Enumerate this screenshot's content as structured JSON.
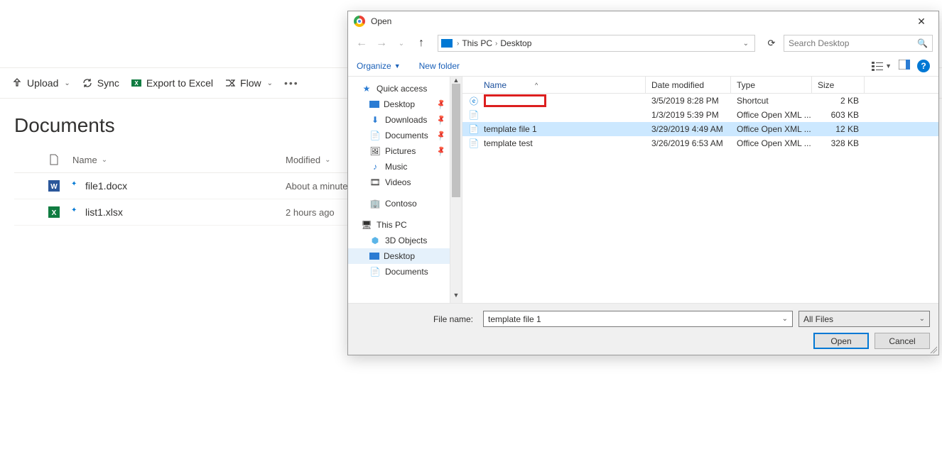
{
  "sharepoint": {
    "toolbar": {
      "upload": "Upload",
      "sync": "Sync",
      "export": "Export to Excel",
      "flow": "Flow"
    },
    "title": "Documents",
    "columns": {
      "name": "Name",
      "modified": "Modified"
    },
    "files": [
      {
        "name": "file1.docx",
        "modified": "About a minute"
      },
      {
        "name": "list1.xlsx",
        "modified": "2 hours ago"
      }
    ]
  },
  "dialog": {
    "title": "Open",
    "breadcrumb": {
      "root": "This PC",
      "leaf": "Desktop"
    },
    "search_placeholder": "Search Desktop",
    "toolbar": {
      "organize": "Organize",
      "newfolder": "New folder"
    },
    "tree": {
      "quick_access": "Quick access",
      "items_pinned": [
        "Desktop",
        "Downloads",
        "Documents",
        "Pictures"
      ],
      "items_plain": [
        "Music",
        "Videos"
      ],
      "contoso": "Contoso",
      "this_pc": "This PC",
      "pc_children": [
        "3D Objects",
        "Desktop",
        "Documents"
      ]
    },
    "columns": {
      "name": "Name",
      "modified": "Date modified",
      "type": "Type",
      "size": "Size"
    },
    "rows": [
      {
        "name": "",
        "modified": "3/5/2019 8:28 PM",
        "type": "Shortcut",
        "size": "2 KB",
        "redacted": true,
        "icon": "edge"
      },
      {
        "name": "",
        "modified": "1/3/2019 5:39 PM",
        "type": "Office Open XML ...",
        "size": "603 KB",
        "redacted": true,
        "icon": "doc"
      },
      {
        "name": "template file 1",
        "modified": "3/29/2019 4:49 AM",
        "type": "Office Open XML ...",
        "size": "12 KB",
        "selected": true,
        "icon": "doc"
      },
      {
        "name": "template test",
        "modified": "3/26/2019 6:53 AM",
        "type": "Office Open XML ...",
        "size": "328 KB",
        "icon": "doc"
      }
    ],
    "filename_label": "File name:",
    "filename_value": "template file 1",
    "filter": "All Files",
    "open_btn": "Open",
    "cancel_btn": "Cancel"
  }
}
